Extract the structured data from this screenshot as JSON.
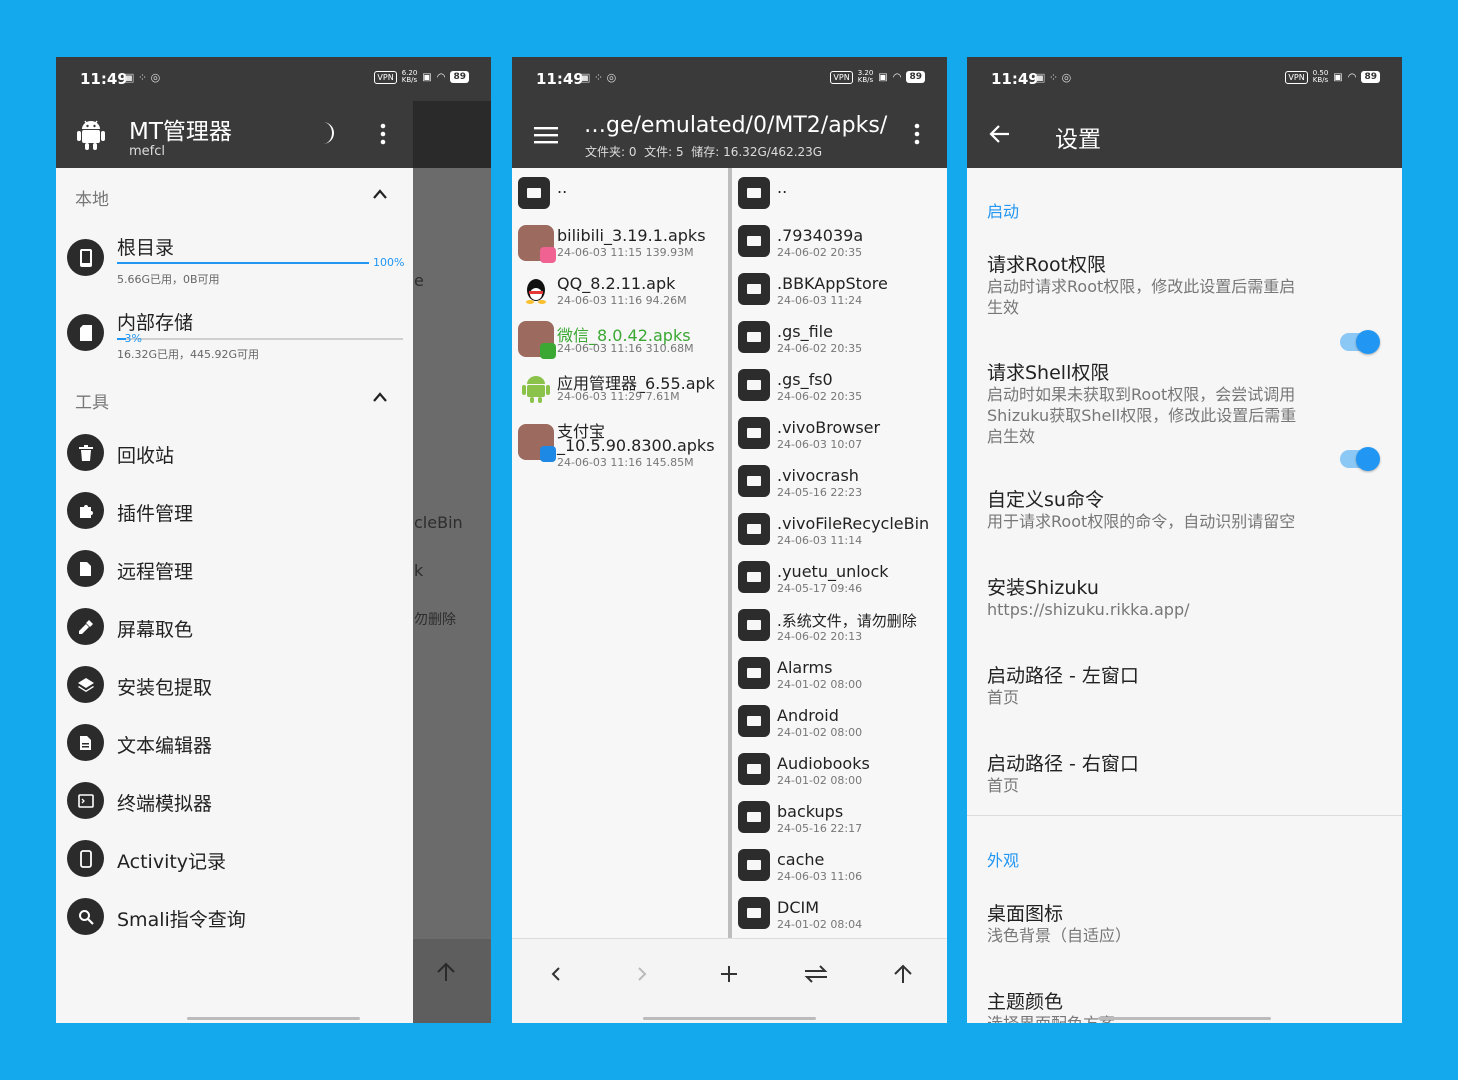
{
  "colors": {
    "background": "#14a8ec",
    "appbar": "#3a3a3a",
    "accent": "#2196f3",
    "green": "#3aa832"
  },
  "status": {
    "time": "11:49",
    "vpn": "VPN",
    "battery": "89",
    "speed1": "6.20",
    "speed2": "3.20",
    "speed3": "0.50",
    "speed_unit": "KB/s"
  },
  "p1": {
    "app_title": "MT管理器",
    "app_subtitle": "mefcl",
    "local_header": "本地",
    "storage": [
      {
        "name": "根目录",
        "sub": "5.66G已用，0B可用",
        "percent": "100%",
        "fill": 100
      },
      {
        "name": "内部存储",
        "sub": "16.32G已用，445.92G可用",
        "percent": "3%",
        "fill": 3
      }
    ],
    "tools_header": "工具",
    "tools": [
      {
        "label": "回收站",
        "icon": "trash-icon"
      },
      {
        "label": "插件管理",
        "icon": "puzzle-icon"
      },
      {
        "label": "远程管理",
        "icon": "document-icon"
      },
      {
        "label": "屏幕取色",
        "icon": "eyedropper-icon"
      },
      {
        "label": "安装包提取",
        "icon": "layers-icon"
      },
      {
        "label": "文本编辑器",
        "icon": "text-document-icon"
      },
      {
        "label": "终端模拟器",
        "icon": "terminal-icon"
      },
      {
        "label": "Activity记录",
        "icon": "phone-icon"
      },
      {
        "label": "Smali指令查询",
        "icon": "search-icon"
      }
    ],
    "behind_texts": [
      "e",
      "cleBin",
      "k",
      "勿删除"
    ]
  },
  "p2": {
    "path": "…ge/emulated/0/MT2/apks/",
    "info": "文件夹: 0  文件: 5  储存: 16.32G/462.23G",
    "left_files": [
      {
        "name": "..",
        "meta": "",
        "type": "folder"
      },
      {
        "name": "bilibili_3.19.1.apks",
        "meta": "24-06-03 11:15  139.93M",
        "type": "apks-bili"
      },
      {
        "name": "QQ_8.2.11.apk",
        "meta": "24-06-03 11:16  94.26M",
        "type": "qq"
      },
      {
        "name": "微信_8.0.42.apks",
        "meta": "24-06-03 11:16  310.68M",
        "type": "apks-wechat"
      },
      {
        "name": "应用管理器_6.55.apk",
        "meta": "24-06-03 11:29  7.61M",
        "type": "android"
      },
      {
        "name": "支付宝",
        "name2": "_10.5.90.8300.apks",
        "meta": "24-06-03 11:16  145.85M",
        "type": "apks-alipay"
      }
    ],
    "right_files": [
      {
        "name": "..",
        "meta": ""
      },
      {
        "name": ".7934039a",
        "meta": "24-06-02 20:35"
      },
      {
        "name": ".BBKAppStore",
        "meta": "24-06-03 11:24"
      },
      {
        "name": ".gs_file",
        "meta": "24-06-02 20:35"
      },
      {
        "name": ".gs_fs0",
        "meta": "24-06-02 20:35"
      },
      {
        "name": ".vivoBrowser",
        "meta": "24-06-03 10:07"
      },
      {
        "name": ".vivocrash",
        "meta": "24-05-16 22:23"
      },
      {
        "name": ".vivoFileRecycleBin",
        "meta": "24-06-03 11:14"
      },
      {
        "name": ".yuetu_unlock",
        "meta": "24-05-17 09:46"
      },
      {
        "name": ".系统文件，请勿删除",
        "meta": "24-06-02 20:13"
      },
      {
        "name": "Alarms",
        "meta": "24-01-02 08:00"
      },
      {
        "name": "Android",
        "meta": "24-01-02 08:00"
      },
      {
        "name": "Audiobooks",
        "meta": "24-01-02 08:00"
      },
      {
        "name": "backups",
        "meta": "24-05-16 22:17"
      },
      {
        "name": "cache",
        "meta": "24-06-03 11:06"
      },
      {
        "name": "DCIM",
        "meta": "24-01-02 08:04"
      }
    ]
  },
  "p3": {
    "title": "设置",
    "cat_startup": "启动",
    "settings": [
      {
        "title": "请求Root权限",
        "sub": "启动时请求Root权限，修改此设置后需重启生效",
        "toggle": true
      },
      {
        "title": "请求Shell权限",
        "sub": "启动时如果未获取到Root权限，会尝试调用Shizuku获取Shell权限，修改此设置后需重启生效",
        "toggle": true
      },
      {
        "title": "自定义su命令",
        "sub": "用于请求Root权限的命令，自动识别请留空"
      },
      {
        "title": "安装Shizuku",
        "sub": "https://shizuku.rikka.app/"
      },
      {
        "title": "启动路径 - 左窗口",
        "sub": "首页"
      },
      {
        "title": "启动路径 - 右窗口",
        "sub": "首页"
      }
    ],
    "cat_appearance": "外观",
    "appearance": [
      {
        "title": "桌面图标",
        "sub": "浅色背景（自适应）"
      },
      {
        "title": "主题颜色",
        "sub": "选择界面配色方案"
      }
    ]
  }
}
